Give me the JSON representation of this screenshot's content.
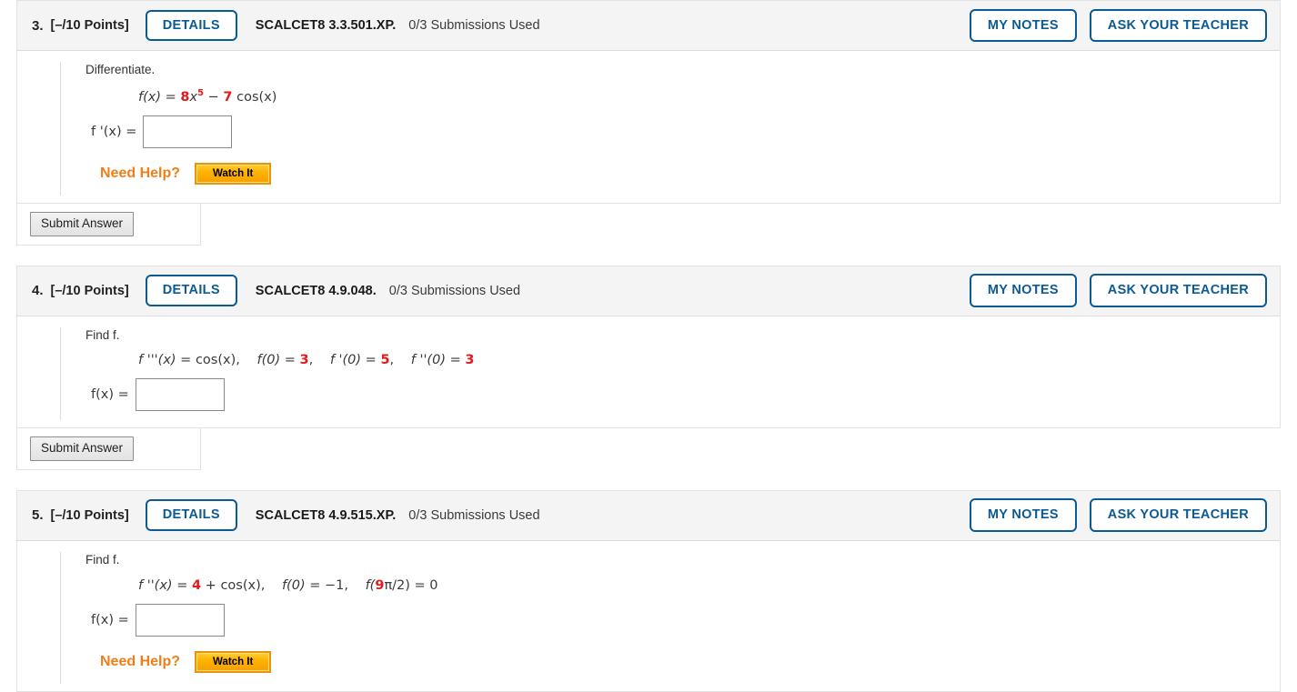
{
  "colors": {
    "accent_blue": "#0b5a94",
    "header_bg": "#f4f4f4",
    "math_red": "#e01b1b",
    "need_help_orange": "#f07e18",
    "watch_it_orange": "#ffb400"
  },
  "common": {
    "details_label": "DETAILS",
    "my_notes_label": "MY NOTES",
    "ask_your_teacher_label": "ASK YOUR TEACHER",
    "submit_label": "Submit Answer",
    "need_help_label": "Need Help?",
    "watch_it_label": "Watch It",
    "submissions_used": "0/3 Submissions Used",
    "points": "[–/10 Points]"
  },
  "questions": [
    {
      "number": "3.",
      "points": "[–/10 Points]",
      "code": "SCALCET8 3.3.501.XP.",
      "submissions": "0/3 Submissions Used",
      "prompt": "Differentiate.",
      "equation_plain": "f(x) = 8x^5 − 7 cos(x)",
      "equation_parts": {
        "lhs": "f(x)",
        "eq": "=",
        "coef1": "8",
        "var1": "x",
        "exp1": "5",
        "minus": "−",
        "coef2": "7",
        "term2": "cos(x)"
      },
      "answer_label_plain": "f '(x) =",
      "answer_value": "",
      "has_need_help": true,
      "has_submit": true
    },
    {
      "number": "4.",
      "points": "[–/10 Points]",
      "code": "SCALCET8 4.9.048.",
      "submissions": "0/3 Submissions Used",
      "prompt": "Find f.",
      "equation_plain": "f '''(x) = cos(x),   f(0) = 3,   f '(0) = 5,   f ''(0) = 3",
      "equation_parts": {
        "lhs": "f '''(x)",
        "rhs": "cos(x)",
        "cond1_lhs": "f(0)",
        "cond1_val": "3",
        "cond2_lhs": "f '(0)",
        "cond2_val": "5",
        "cond3_lhs": "f ''(0)",
        "cond3_val": "3"
      },
      "answer_label_plain": "f(x) =",
      "answer_value": "",
      "has_need_help": false,
      "has_submit": true
    },
    {
      "number": "5.",
      "points": "[–/10 Points]",
      "code": "SCALCET8 4.9.515.XP.",
      "submissions": "0/3 Submissions Used",
      "prompt": "Find f.",
      "equation_plain": "f ''(x) = 4 + cos(x),   f(0) = −1,   f(9π/2) = 0",
      "equation_parts": {
        "lhs": "f ''(x)",
        "coef": "4",
        "plus": "+",
        "rhs": "cos(x)",
        "cond1_lhs": "f(0)",
        "cond1_val": "−1",
        "cond2_coef": "9",
        "cond2_rest": "π/2) = 0"
      },
      "answer_label_plain": "f(x) =",
      "answer_value": "",
      "has_need_help": true,
      "has_submit": false
    }
  ]
}
